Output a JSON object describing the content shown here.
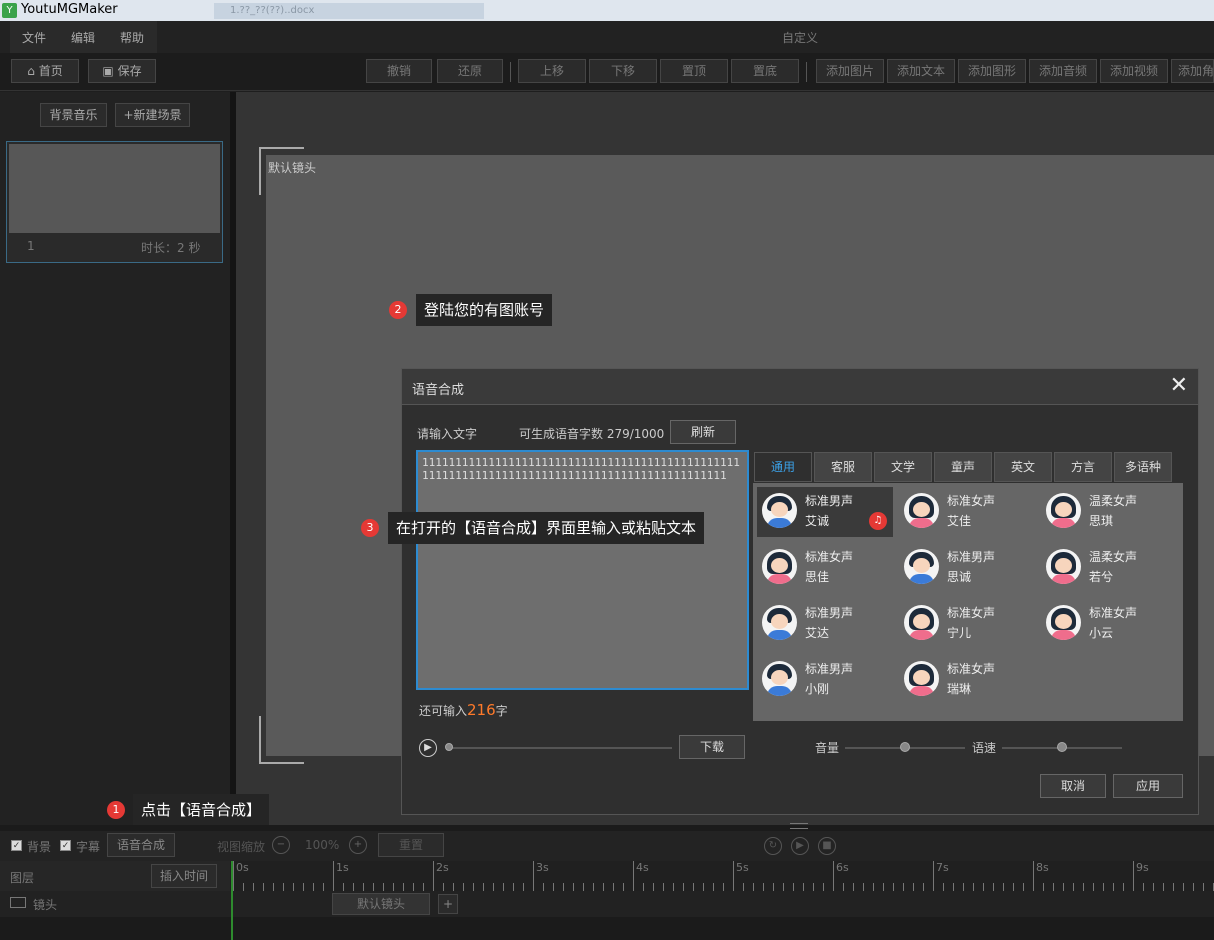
{
  "window": {
    "app_title": "YoutuMGMaker",
    "taskbar_tab": "1.??_??(??)..docx",
    "doc_title": "自定义"
  },
  "menu": [
    "文件",
    "编辑",
    "帮助"
  ],
  "toolbar": {
    "home": "首页",
    "save": "保存",
    "undo": "撤销",
    "redo": "还原",
    "up": "上移",
    "down": "下移",
    "top": "置顶",
    "bottom": "置底",
    "add_image": "添加图片",
    "add_text": "添加文本",
    "add_shape": "添加图形",
    "add_audio": "添加音频",
    "add_video": "添加视频",
    "add_role": "添加角"
  },
  "left": {
    "bg_music": "背景音乐",
    "new_scene": "+新建场景",
    "scene_index": "1",
    "scene_duration": "时长：2 秒"
  },
  "stage": {
    "camera_label": "默认镜头"
  },
  "tips": [
    {
      "num": "1",
      "text": "点击【语音合成】"
    },
    {
      "num": "2",
      "text": "登陆您的有图账号"
    },
    {
      "num": "3",
      "text": "在打开的【语音合成】界面里输入或粘贴文本"
    }
  ],
  "dialog": {
    "title": "语音合成",
    "close": "✕",
    "input_label": "请输入文字",
    "quota": "可生成语音字数 279/1000",
    "refresh": "刷新",
    "text": "1111111111111111111111111111111111111111111111111111111111111111111111111111111111111111111111",
    "remain_prefix": "还可输入",
    "remain_count": "216",
    "remain_suffix": "字",
    "download": "下载",
    "volume": "音量",
    "speed": "语速",
    "volume_level": 0.5,
    "speed_level": 0.5,
    "cancel": "取消",
    "apply": "应用",
    "tabs": [
      "通用",
      "客服",
      "文学",
      "童声",
      "英文",
      "方言",
      "多语种"
    ],
    "voices": [
      {
        "type": "标准男声",
        "name": "艾诚",
        "gender": "m"
      },
      {
        "type": "标准女声",
        "name": "艾佳",
        "gender": "f"
      },
      {
        "type": "温柔女声",
        "name": "思琪",
        "gender": "f"
      },
      {
        "type": "标准女声",
        "name": "思佳",
        "gender": "f"
      },
      {
        "type": "标准男声",
        "name": "思诚",
        "gender": "m"
      },
      {
        "type": "温柔女声",
        "name": "若兮",
        "gender": "f"
      },
      {
        "type": "标准男声",
        "name": "艾达",
        "gender": "m"
      },
      {
        "type": "标准女声",
        "name": "宁儿",
        "gender": "f"
      },
      {
        "type": "标准女声",
        "name": "小云",
        "gender": "f"
      },
      {
        "type": "标准男声",
        "name": "小刚",
        "gender": "m"
      },
      {
        "type": "标准女声",
        "name": "瑞琳",
        "gender": "f"
      }
    ]
  },
  "timeline": {
    "bg_label": "背景",
    "subtitle_label": "字幕",
    "tts_button": "语音合成",
    "zoom_label": "视图缩放",
    "zoom_value": "100%",
    "reset": "重置",
    "layer_label": "图层",
    "insert_time": "插入时间",
    "camera_row": "镜头",
    "camera_clip": "默认镜头",
    "ticks": [
      "0s",
      "1s",
      "2s",
      "3s",
      "4s",
      "5s",
      "6s",
      "7s",
      "8s",
      "9s"
    ]
  }
}
